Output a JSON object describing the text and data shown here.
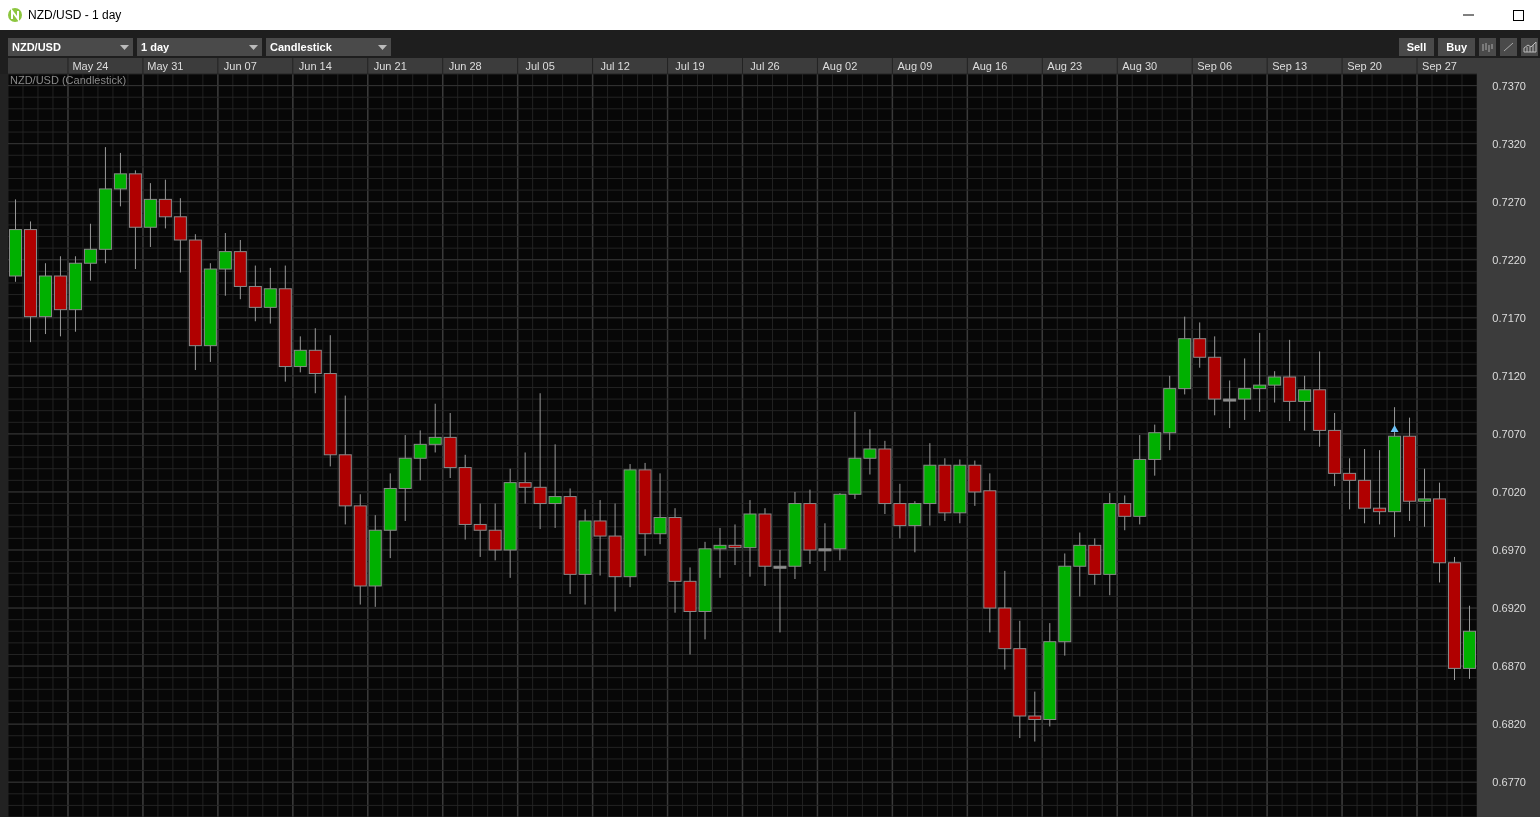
{
  "window": {
    "title": "NZD/USD - 1 day"
  },
  "toolbar": {
    "dropdowns": [
      {
        "value": "NZD/USD"
      },
      {
        "value": "1 day"
      },
      {
        "value": "Candlestick"
      }
    ],
    "buttons": [
      "Sell",
      "Buy"
    ]
  },
  "chart": {
    "legend": "NZD/USD (Candlestick)",
    "chart_data": {
      "type": "candlestick",
      "ylim": [
        0.674,
        0.738
      ],
      "categories": [
        null,
        null,
        null,
        null,
        null,
        "May 24",
        null,
        null,
        null,
        null,
        "May 31",
        null,
        null,
        null,
        null,
        "Jun 07",
        null,
        null,
        null,
        null,
        "Jun 14",
        null,
        null,
        null,
        null,
        "Jun 21",
        null,
        null,
        null,
        null,
        "Jun 28",
        null,
        null,
        null,
        null,
        "Jul 05",
        null,
        null,
        null,
        null,
        "Jul 12",
        null,
        null,
        null,
        null,
        "Jul 19",
        null,
        null,
        null,
        null,
        "Jul 26",
        null,
        null,
        null,
        null,
        "Aug 02",
        null,
        null,
        null,
        null,
        "Aug 09",
        null,
        null,
        null,
        null,
        "Aug 16",
        null,
        null,
        null,
        null,
        "Aug 23",
        null,
        null,
        null,
        null,
        "Aug 30",
        null,
        null,
        null,
        null,
        "Sep 06",
        null,
        null,
        null,
        null,
        "Sep 13",
        null,
        null,
        null,
        null,
        "Sep 20",
        null,
        null,
        null,
        null,
        "Sep 27",
        null,
        null
      ],
      "yticks": [
        {
          "value": 0.737,
          "label": "0.7370"
        },
        {
          "value": 0.732,
          "label": "0.7320"
        },
        {
          "value": 0.727,
          "label": "0.7270"
        },
        {
          "value": 0.722,
          "label": "0.7220"
        },
        {
          "value": 0.717,
          "label": "0.7170"
        },
        {
          "value": 0.712,
          "label": "0.7120"
        },
        {
          "value": 0.707,
          "label": "0.7070"
        },
        {
          "value": 0.702,
          "label": "0.7020"
        },
        {
          "value": 0.697,
          "label": "0.6970"
        },
        {
          "value": 0.692,
          "label": "0.6920"
        },
        {
          "value": 0.687,
          "label": "0.6870"
        },
        {
          "value": 0.682,
          "label": "0.6820"
        },
        {
          "value": 0.677,
          "label": "0.6770"
        }
      ],
      "ohlc": [
        [
          0.7206,
          0.7272,
          0.7201,
          0.7246
        ],
        [
          0.7246,
          0.7253,
          0.7149,
          0.7171
        ],
        [
          0.7171,
          0.7217,
          0.7156,
          0.7206
        ],
        [
          0.7206,
          0.7223,
          0.7154,
          0.7177
        ],
        [
          0.7177,
          0.7223,
          0.7158,
          0.7217
        ],
        [
          0.7217,
          0.7251,
          0.7202,
          0.7229
        ],
        [
          0.7229,
          0.7317,
          0.7217,
          0.7281
        ],
        [
          0.7281,
          0.7312,
          0.7266,
          0.7294
        ],
        [
          0.7294,
          0.7297,
          0.7212,
          0.7248
        ],
        [
          0.7248,
          0.7286,
          0.7231,
          0.7272
        ],
        [
          0.7272,
          0.7289,
          0.7247,
          0.7257
        ],
        [
          0.7257,
          0.7273,
          0.7209,
          0.7237
        ],
        [
          0.7237,
          0.7242,
          0.7125,
          0.7146
        ],
        [
          0.7146,
          0.7217,
          0.7132,
          0.7212
        ],
        [
          0.7212,
          0.7243,
          0.7189,
          0.7227
        ],
        [
          0.7227,
          0.7237,
          0.7186,
          0.7197
        ],
        [
          0.7197,
          0.7215,
          0.7167,
          0.7179
        ],
        [
          0.7179,
          0.7213,
          0.7165,
          0.7195
        ],
        [
          0.7195,
          0.7215,
          0.7115,
          0.7128
        ],
        [
          0.7128,
          0.7154,
          0.7123,
          0.7142
        ],
        [
          0.7142,
          0.7161,
          0.7105,
          0.7122
        ],
        [
          0.7122,
          0.7155,
          0.7042,
          0.7052
        ],
        [
          0.7052,
          0.7103,
          0.6992,
          0.7008
        ],
        [
          0.7008,
          0.7018,
          0.6923,
          0.6939
        ],
        [
          0.6939,
          0.7,
          0.6921,
          0.6987
        ],
        [
          0.6987,
          0.7036,
          0.6963,
          0.7023
        ],
        [
          0.7023,
          0.7069,
          0.6995,
          0.7049
        ],
        [
          0.7049,
          0.7073,
          0.703,
          0.7061
        ],
        [
          0.7061,
          0.7096,
          0.7054,
          0.7067
        ],
        [
          0.7067,
          0.7088,
          0.7032,
          0.7041
        ],
        [
          0.7041,
          0.7052,
          0.6979,
          0.6992
        ],
        [
          0.6992,
          0.701,
          0.6964,
          0.6987
        ],
        [
          0.6987,
          0.701,
          0.6961,
          0.697
        ],
        [
          0.697,
          0.704,
          0.6946,
          0.7028
        ],
        [
          0.7028,
          0.7054,
          0.701,
          0.7024
        ],
        [
          0.7024,
          0.7105,
          0.6988,
          0.701
        ],
        [
          0.701,
          0.7061,
          0.6989,
          0.7016
        ],
        [
          0.7016,
          0.7023,
          0.6932,
          0.6949
        ],
        [
          0.6949,
          0.7005,
          0.6923,
          0.6995
        ],
        [
          0.6995,
          0.7013,
          0.6948,
          0.6982
        ],
        [
          0.6982,
          0.701,
          0.6917,
          0.6947
        ],
        [
          0.6947,
          0.7044,
          0.6938,
          0.7039
        ],
        [
          0.7039,
          0.7045,
          0.6965,
          0.6984
        ],
        [
          0.6984,
          0.7036,
          0.6975,
          0.6998
        ],
        [
          0.6998,
          0.7006,
          0.6916,
          0.6943
        ],
        [
          0.6943,
          0.6955,
          0.688,
          0.6917
        ],
        [
          0.6917,
          0.6977,
          0.6893,
          0.6971
        ],
        [
          0.6971,
          0.6989,
          0.6946,
          0.6974
        ],
        [
          0.6974,
          0.6992,
          0.6957,
          0.6972
        ],
        [
          0.6972,
          0.7013,
          0.6947,
          0.7001
        ],
        [
          0.7001,
          0.7006,
          0.6939,
          0.6956
        ],
        [
          0.6956,
          0.697,
          0.6899,
          0.6956
        ],
        [
          0.6956,
          0.702,
          0.6945,
          0.701
        ],
        [
          0.701,
          0.7022,
          0.6958,
          0.697
        ],
        [
          0.6971,
          0.6993,
          0.6952,
          0.6971
        ],
        [
          0.6971,
          0.7019,
          0.6961,
          0.7018
        ],
        [
          0.7018,
          0.7089,
          0.7014,
          0.7049
        ],
        [
          0.7049,
          0.7074,
          0.7035,
          0.7057
        ],
        [
          0.7057,
          0.7064,
          0.7001,
          0.701
        ],
        [
          0.701,
          0.7027,
          0.698,
          0.6991
        ],
        [
          0.6991,
          0.7012,
          0.6968,
          0.701
        ],
        [
          0.701,
          0.7062,
          0.6991,
          0.7043
        ],
        [
          0.7043,
          0.7049,
          0.6995,
          0.7002
        ],
        [
          0.7002,
          0.7048,
          0.6993,
          0.7043
        ],
        [
          0.7043,
          0.7047,
          0.7008,
          0.702
        ],
        [
          0.7021,
          0.7036,
          0.6899,
          0.692
        ],
        [
          0.692,
          0.6952,
          0.6867,
          0.6885
        ],
        [
          0.6885,
          0.6909,
          0.6808,
          0.6827
        ],
        [
          0.6827,
          0.6848,
          0.6805,
          0.6824
        ],
        [
          0.6824,
          0.6907,
          0.6818,
          0.6891
        ],
        [
          0.6891,
          0.6967,
          0.6879,
          0.6956
        ],
        [
          0.6956,
          0.6985,
          0.693,
          0.6974
        ],
        [
          0.6974,
          0.698,
          0.694,
          0.6949
        ],
        [
          0.6949,
          0.7019,
          0.6931,
          0.701
        ],
        [
          0.701,
          0.7017,
          0.6987,
          0.6999
        ],
        [
          0.6999,
          0.7069,
          0.6992,
          0.7048
        ],
        [
          0.7048,
          0.7078,
          0.7034,
          0.7071
        ],
        [
          0.7071,
          0.712,
          0.7056,
          0.7109
        ],
        [
          0.7109,
          0.7171,
          0.7104,
          0.7152
        ],
        [
          0.7152,
          0.7166,
          0.7127,
          0.7136
        ],
        [
          0.7136,
          0.7154,
          0.7086,
          0.71
        ],
        [
          0.71,
          0.7116,
          0.7075,
          0.71
        ],
        [
          0.71,
          0.7135,
          0.7082,
          0.7109
        ],
        [
          0.7109,
          0.7157,
          0.7089,
          0.7112
        ],
        [
          0.7112,
          0.7124,
          0.7097,
          0.7119
        ],
        [
          0.7119,
          0.7151,
          0.7081,
          0.7098
        ],
        [
          0.7098,
          0.712,
          0.7073,
          0.7108
        ],
        [
          0.7108,
          0.7141,
          0.7059,
          0.7073
        ],
        [
          0.7073,
          0.7088,
          0.7025,
          0.7036
        ],
        [
          0.7036,
          0.7049,
          0.7005,
          0.703
        ],
        [
          0.703,
          0.7057,
          0.6993,
          0.7006
        ],
        [
          0.7006,
          0.7056,
          0.6992,
          0.7003
        ],
        [
          0.7003,
          0.7093,
          0.6981,
          0.7068
        ],
        [
          0.7068,
          0.7084,
          0.6995,
          0.7012
        ],
        [
          0.7012,
          0.704,
          0.699,
          0.7014
        ],
        [
          0.7014,
          0.7028,
          0.6942,
          0.6959
        ],
        [
          0.6959,
          0.6964,
          0.6858,
          0.6868
        ],
        [
          0.6868,
          0.6922,
          0.6859,
          0.69
        ]
      ],
      "grid": true
    }
  }
}
